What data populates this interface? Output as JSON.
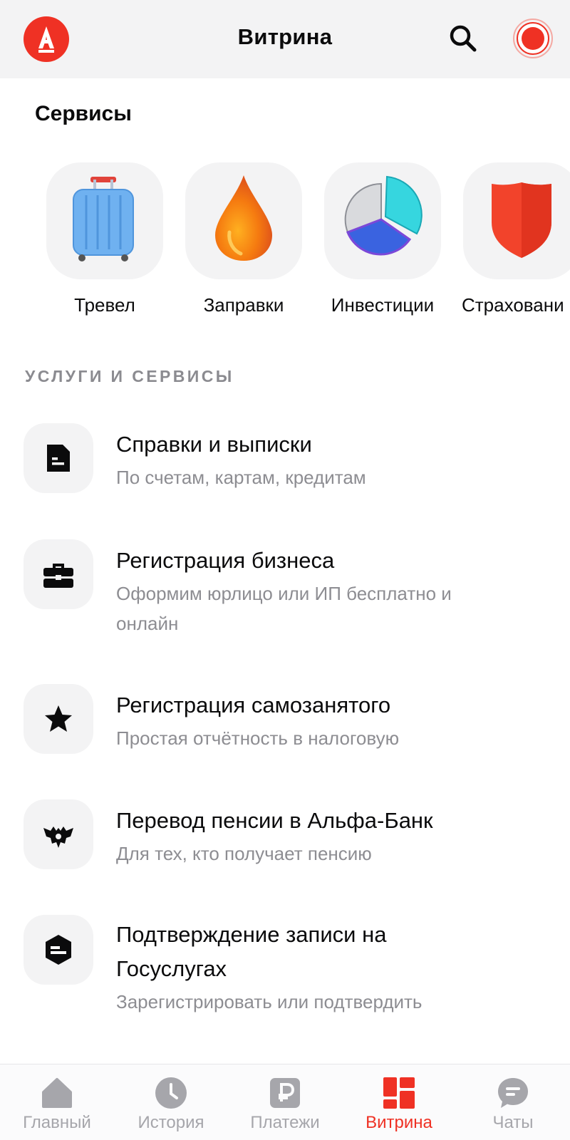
{
  "header": {
    "title": "Витрина"
  },
  "services": {
    "title": "Сервисы",
    "items": [
      {
        "label": "Тревел",
        "icon": "suitcase-icon"
      },
      {
        "label": "Заправки",
        "icon": "fuel-drop-icon"
      },
      {
        "label": "Инвестиции",
        "icon": "pie-chart-icon"
      },
      {
        "label": "Страховани",
        "icon": "shield-icon"
      }
    ]
  },
  "list": {
    "header": "УСЛУГИ И СЕРВИСЫ",
    "items": [
      {
        "title": "Справки и выписки",
        "subtitle": "По счетам, картам, кредитам",
        "icon": "document-icon"
      },
      {
        "title": "Регистрация бизнеса",
        "subtitle": "Оформим юрлицо или ИП бесплатно и онлайн",
        "icon": "briefcase-icon"
      },
      {
        "title": "Регистрация самозанятого",
        "subtitle": "Простая отчётность в налоговую",
        "icon": "star-icon"
      },
      {
        "title": "Перевод пенсии в Альфа-Банк",
        "subtitle": "Для тех, кто получает пенсию",
        "icon": "coat-of-arms-icon"
      },
      {
        "title": "Подтверждение записи на Госуслугах",
        "subtitle": "Зарегистрировать или подтвердить",
        "icon": "gosuslugi-icon"
      }
    ]
  },
  "tabs": [
    {
      "label": "Главный",
      "icon": "home-icon",
      "active": false
    },
    {
      "label": "История",
      "icon": "clock-icon",
      "active": false
    },
    {
      "label": "Платежи",
      "icon": "ruble-icon",
      "active": false
    },
    {
      "label": "Витрина",
      "icon": "showcase-icon",
      "active": true
    },
    {
      "label": "Чаты",
      "icon": "chat-icon",
      "active": false
    }
  ],
  "colors": {
    "accent": "#ef3124",
    "tile": "#f3f3f4",
    "muted": "#8d8d92",
    "inactive_tab": "#a6a6ab"
  }
}
